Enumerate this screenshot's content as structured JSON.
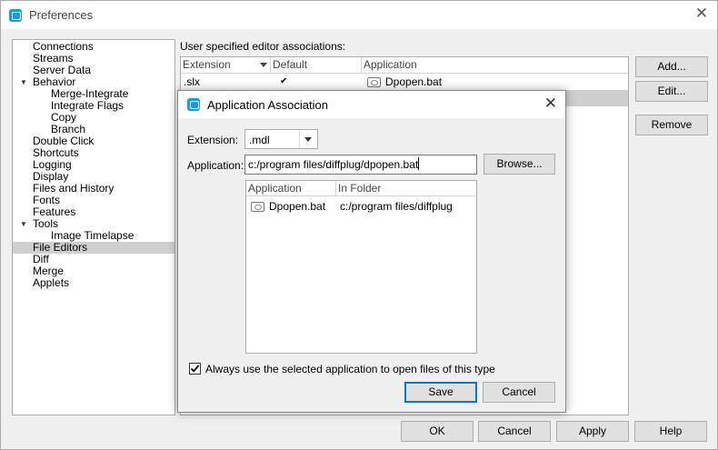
{
  "window": {
    "title": "Preferences",
    "close_glyph": "✕"
  },
  "tree": {
    "items": [
      {
        "label": "Connections",
        "indent": 0
      },
      {
        "label": "Streams",
        "indent": 0
      },
      {
        "label": "Server Data",
        "indent": 0
      },
      {
        "label": "Behavior",
        "indent": 0,
        "expanded": true
      },
      {
        "label": "Merge-Integrate",
        "indent": 1
      },
      {
        "label": "Integrate Flags",
        "indent": 1
      },
      {
        "label": "Copy",
        "indent": 1
      },
      {
        "label": "Branch",
        "indent": 1
      },
      {
        "label": "Double Click",
        "indent": 0
      },
      {
        "label": "Shortcuts",
        "indent": 0
      },
      {
        "label": "Logging",
        "indent": 0
      },
      {
        "label": "Display",
        "indent": 0
      },
      {
        "label": "Files and History",
        "indent": 0
      },
      {
        "label": "Fonts",
        "indent": 0
      },
      {
        "label": "Features",
        "indent": 0
      },
      {
        "label": "Tools",
        "indent": 0,
        "expanded": true
      },
      {
        "label": "Image Timelapse",
        "indent": 1
      },
      {
        "label": "File Editors",
        "indent": 0,
        "selected": true
      },
      {
        "label": "Diff",
        "indent": 0
      },
      {
        "label": "Merge",
        "indent": 0
      },
      {
        "label": "Applets",
        "indent": 0
      }
    ]
  },
  "associations": {
    "label": "User specified editor associations:",
    "columns": [
      "Extension",
      "Default",
      "Application"
    ],
    "rows": [
      {
        "extension": ".slx",
        "default": "✔",
        "application": "Dpopen.bat"
      },
      {
        "extension": "",
        "default": "",
        "application": "",
        "selected": true
      }
    ]
  },
  "side_buttons": {
    "add": "Add...",
    "edit": "Edit...",
    "remove": "Remove"
  },
  "bottom_buttons": {
    "ok": "OK",
    "cancel": "Cancel",
    "apply": "Apply",
    "help": "Help"
  },
  "dialog": {
    "title": "Application Association",
    "close_glyph": "✕",
    "extension_label": "Extension:",
    "extension_value": ".mdl",
    "application_label": "Application:",
    "application_value": "c:/program files/diffplug/dpopen.bat",
    "browse": "Browse...",
    "list_columns": [
      "Application",
      "In Folder"
    ],
    "list_rows": [
      {
        "application": "Dpopen.bat",
        "folder": "c:/program files/diffplug"
      }
    ],
    "checkbox_label": "Always use the selected application to open files of this type",
    "checkbox_checked": true,
    "save": "Save",
    "cancel": "Cancel"
  }
}
